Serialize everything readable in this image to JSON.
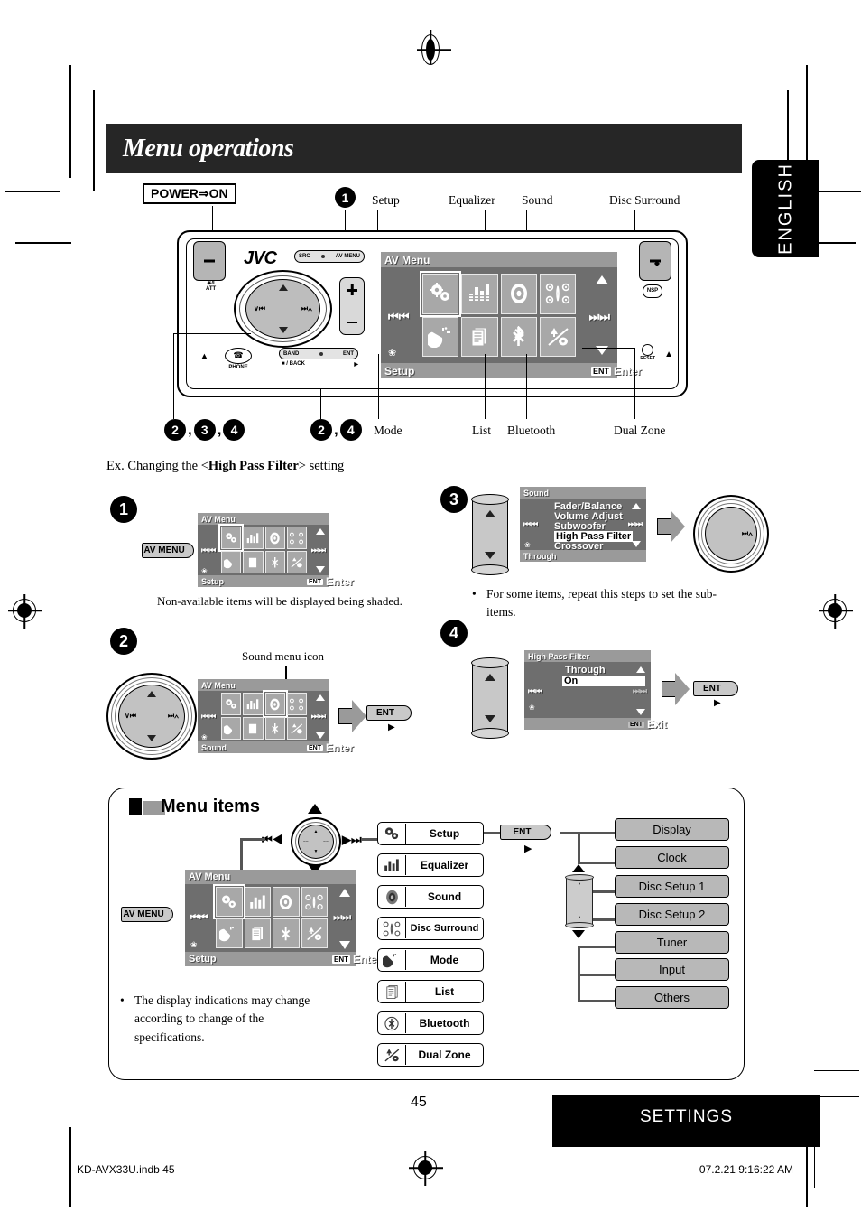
{
  "page": {
    "title": "Menu operations",
    "language_tab": "ENGLISH",
    "page_number": "45",
    "section_label": "SETTINGS",
    "file_name": "KD-AVX33U.indb   45",
    "time_stamp": "07.2.21   9:16:22 AM"
  },
  "unit": {
    "power_label": "POWER⇒ON",
    "brand": "JVC",
    "src_button": "SRC",
    "avmenu_button": "AV MENU",
    "band_button": "BAND",
    "back_button": "■ / BACK",
    "ent_button": "ENT",
    "phone_label": "PHONE",
    "reset_label": "RESET",
    "att_label": "ATT",
    "nsp_label": "NSP",
    "volume_plus": "+",
    "volume_minus": "−"
  },
  "callouts": {
    "top": [
      {
        "label": "Setup"
      },
      {
        "label": "Equalizer"
      },
      {
        "label": "Sound"
      },
      {
        "label": "Disc Surround"
      }
    ],
    "bottom": [
      {
        "label": "Mode"
      },
      {
        "label": "List"
      },
      {
        "label": "Bluetooth"
      },
      {
        "label": "Dual Zone"
      }
    ],
    "marker_1": "1",
    "marker_group_a": "2",
    "marker_group_b": "3",
    "marker_group_c": "4",
    "marker_group_d": "2",
    "marker_group_e": "4",
    "comma": ","
  },
  "example": {
    "intro_prefix": "Ex. Changing the <",
    "intro_bold": "High Pass Filter",
    "intro_suffix": "> setting",
    "step1": {
      "number": "1",
      "button": "AV MENU",
      "note": "Non-available items will be displayed being shaded.",
      "screen": {
        "title": "AV Menu",
        "footer_left": "Setup",
        "footer_right_chip": "ENT",
        "footer_right": "Enter",
        "icons": [
          "setup-icon",
          "equalizer-icon",
          "sound-icon",
          "disc-surround-icon",
          "mode-icon",
          "list-icon",
          "bluetooth-icon",
          "dual-zone-icon"
        ],
        "selected_index": 0
      }
    },
    "step2": {
      "number": "2",
      "annotation": "Sound menu icon",
      "button": "ENT",
      "screen": {
        "title": "AV Menu",
        "footer_left": "Sound",
        "footer_right_chip": "ENT",
        "footer_right": "Enter",
        "selected_index": 2
      }
    },
    "step3": {
      "number": "3",
      "note": "For some items, repeat this steps to set the sub-items.",
      "screen": {
        "title": "Sound",
        "items": [
          "Fader/Balance",
          "Volume Adjust",
          "Subwoofer",
          "High Pass Filter",
          "Crossover"
        ],
        "highlighted": "High Pass Filter",
        "footer_left": "Through"
      }
    },
    "step4": {
      "number": "4",
      "button": "ENT",
      "screen": {
        "title": "High Pass Filter",
        "items": [
          "Through",
          "On"
        ],
        "highlighted": "On",
        "footer_right_chip": "ENT",
        "footer_right": "Exit"
      }
    }
  },
  "menu_items": {
    "heading": "Menu items",
    "button": "AV MENU",
    "note": "The display indications may change according to change of the specifications.",
    "screen": {
      "title": "AV Menu",
      "footer_left": "Setup",
      "footer_right_chip": "ENT",
      "footer_right": "Enter"
    },
    "ent_label": "ENT",
    "main": [
      {
        "label": "Setup",
        "icon": "setup-icon"
      },
      {
        "label": "Equalizer",
        "icon": "equalizer-icon"
      },
      {
        "label": "Sound",
        "icon": "sound-icon"
      },
      {
        "label": "Disc Surround",
        "icon": "disc-surround-icon"
      },
      {
        "label": "Mode",
        "icon": "mode-icon"
      },
      {
        "label": "List",
        "icon": "list-icon"
      },
      {
        "label": "Bluetooth",
        "icon": "bluetooth-icon"
      },
      {
        "label": "Dual Zone",
        "icon": "dual-zone-icon"
      }
    ],
    "sub": [
      {
        "label": "Display"
      },
      {
        "label": "Clock"
      },
      {
        "label": "Disc Setup 1"
      },
      {
        "label": "Disc Setup 2"
      },
      {
        "label": "Tuner"
      },
      {
        "label": "Input"
      },
      {
        "label": "Others"
      }
    ]
  },
  "colors": {
    "lcd_bg": "#6e6e6e",
    "lcd_bar": "#9a9a9a",
    "lcd_cell": "#a8a8a8",
    "accent_black": "#000000",
    "button_grey": "#c9c9c9",
    "sub_box": "#b8b8b8"
  }
}
